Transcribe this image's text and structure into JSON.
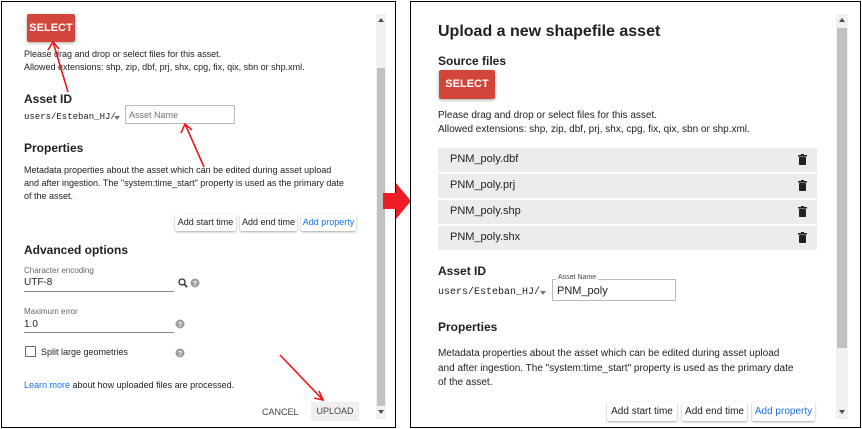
{
  "left_panel": {
    "select_label": "SELECT",
    "drag_text": "Please drag and drop or select files for this asset.",
    "extensions_text": "Allowed extensions: shp, zip, dbf, prj, shx, cpg, fix, qix, sbn or shp.xml.",
    "asset_id_heading": "Asset ID",
    "asset_path": "users/Esteban_HJ/",
    "asset_name_placeholder": "Asset Name",
    "properties_heading": "Properties",
    "properties_text_1": "Metadata properties about the asset which can be edited during asset upload",
    "properties_text_2": "and after ingestion. The \"system:time_start\" property is used as the primary date",
    "properties_text_3": "of the asset.",
    "add_start_time": "Add start time",
    "add_end_time": "Add end time",
    "add_property": "Add property",
    "advanced_heading": "Advanced options",
    "char_encoding_label": "Character encoding",
    "char_encoding_value": "UTF-8",
    "max_error_label": "Maximum error",
    "max_error_value": "1.0",
    "split_label": "Split large geometries",
    "learn_more_link": "Learn more",
    "learn_more_text": " about how uploaded files are processed.",
    "cancel_label": "CANCEL",
    "upload_label": "UPLOAD"
  },
  "right_panel": {
    "title": "Upload a new shapefile asset",
    "source_heading": "Source files",
    "select_label": "SELECT",
    "drag_text": "Please drag and drop or select files for this asset.",
    "extensions_text": "Allowed extensions: shp, zip, dbf, prj, shx, cpg, fix, qix, sbn or shp.xml.",
    "files": [
      "PNM_poly.dbf",
      "PNM_poly.prj",
      "PNM_poly.shp",
      "PNM_poly.shx"
    ],
    "asset_id_heading": "Asset ID",
    "asset_path": "users/Esteban_HJ/",
    "asset_name_label": "Asset Name",
    "asset_name_value": "PNM_poly",
    "properties_heading": "Properties",
    "properties_text_1": "Metadata properties about the asset which can be edited during asset upload",
    "properties_text_2": "and after ingestion. The \"system:time_start\" property is used as the primary date",
    "properties_text_3": "of the asset.",
    "add_start_time": "Add start time",
    "add_end_time": "Add end time",
    "add_property": "Add property"
  },
  "colors": {
    "select_red": "#d2453a",
    "annotation_red": "#e8171b",
    "link_blue": "#1a73e8",
    "file_row_bg": "#ececec"
  }
}
